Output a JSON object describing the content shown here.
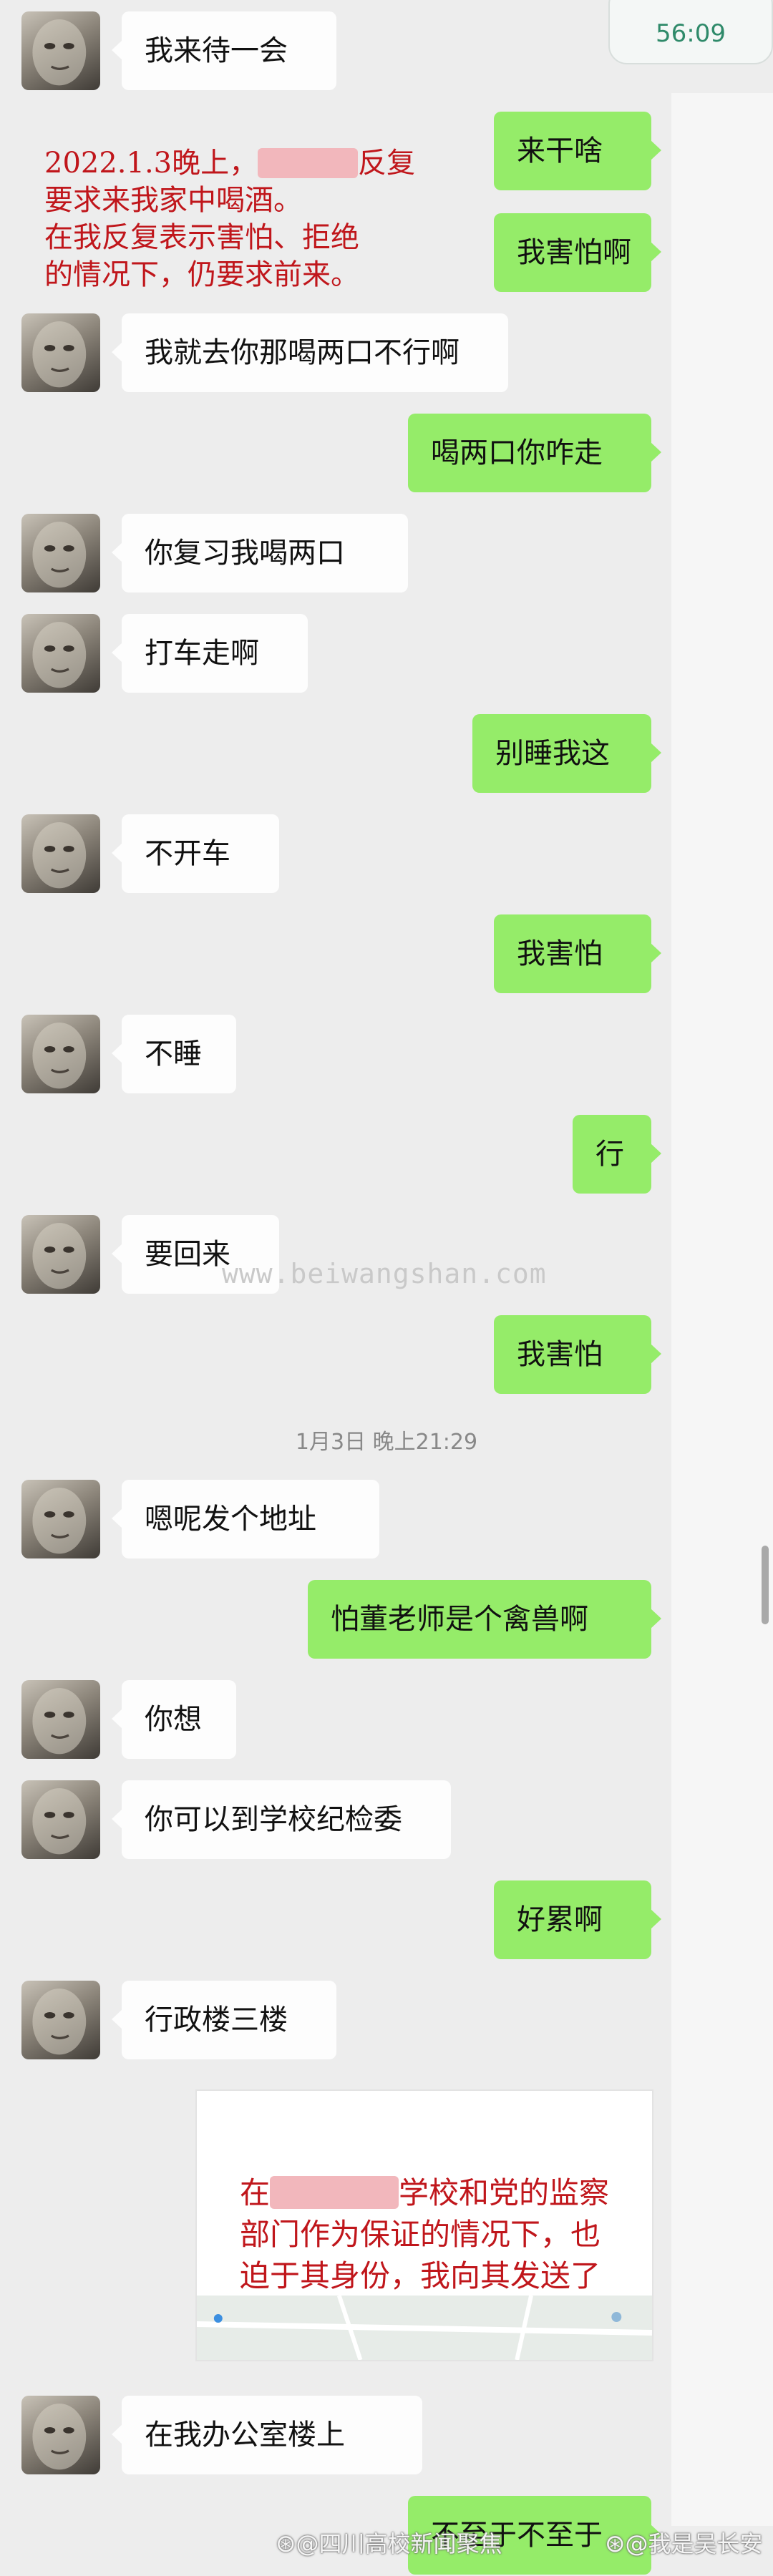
{
  "status_time": "56:09",
  "watermark": "www.beiwangshan.com",
  "annotations": {
    "first_date": "2022.1.3晚上，",
    "first_after": "反复",
    "first_rest": "要求来我家中喝酒。\n在我反复表示害怕、拒绝\n的情况下，仍要求前来。",
    "second_start": "在",
    "second_after": "学校和党的监察",
    "second_rest": "部门作为保证的情况下，也\n迫于其身份，我向其发送了\n地址。"
  },
  "timestamp": "1月3日 晚上21:29",
  "messages": [
    {
      "side": "in",
      "text": "我来待一会"
    },
    {
      "side": "out",
      "text": "来干啥"
    },
    {
      "side": "out",
      "text": "我害怕啊"
    },
    {
      "side": "in",
      "text": "我就去你那喝两口不行啊"
    },
    {
      "side": "out",
      "text": "喝两口你咋走"
    },
    {
      "side": "in",
      "text": "你复习我喝两口"
    },
    {
      "side": "in",
      "text": "打车走啊"
    },
    {
      "side": "out",
      "text": "别睡我这"
    },
    {
      "side": "in",
      "text": "不开车"
    },
    {
      "side": "out",
      "text": "我害怕"
    },
    {
      "side": "in",
      "text": "不睡"
    },
    {
      "side": "out",
      "text": "行"
    },
    {
      "side": "in",
      "text": "要回来"
    },
    {
      "side": "out",
      "text": "我害怕"
    },
    {
      "side": "in",
      "text": "嗯呢发个地址"
    },
    {
      "side": "out",
      "text": "怕董老师是个禽兽啊"
    },
    {
      "side": "in",
      "text": "你想"
    },
    {
      "side": "in",
      "text": "你可以到学校纪检委"
    },
    {
      "side": "out",
      "text": "好累啊"
    },
    {
      "side": "in",
      "text": "行政楼三楼"
    },
    {
      "side": "in",
      "text": "在我办公室楼上"
    },
    {
      "side": "out",
      "text": "不至于不至于"
    }
  ],
  "weibo_left": "@四川高校新闻聚焦",
  "weibo_right": "@我是吴长安"
}
